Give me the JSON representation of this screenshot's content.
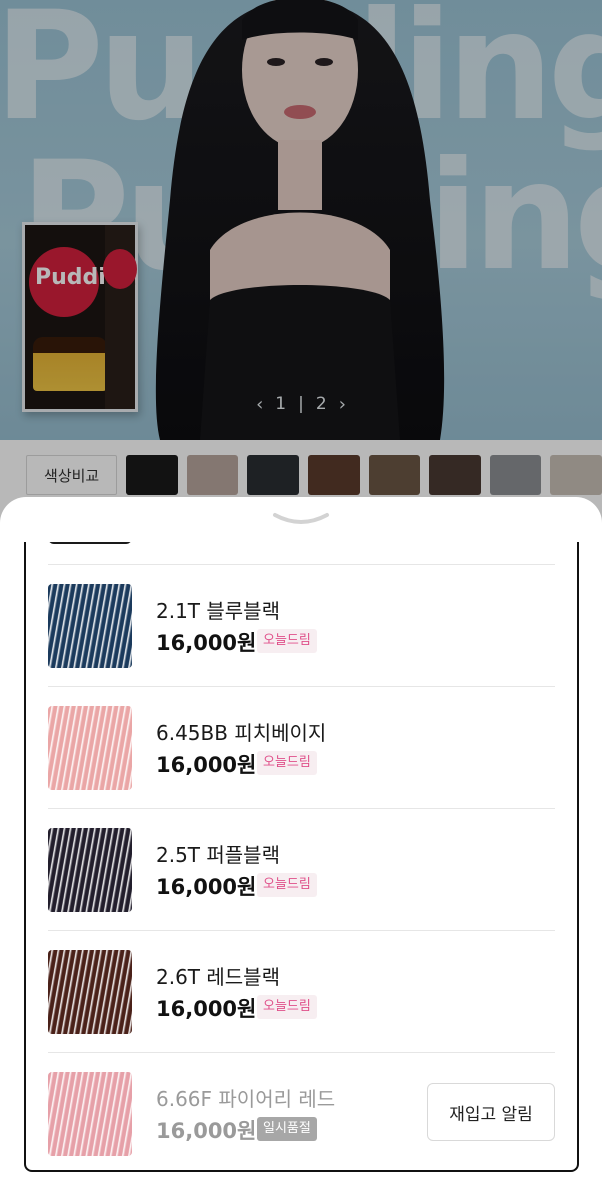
{
  "hero": {
    "bg_text": "Pudding",
    "box_brand": "Pudding",
    "pager": {
      "current": "1",
      "separator": "|",
      "total": "2"
    }
  },
  "swatch_bar": {
    "compare_label": "색상비교",
    "swatch_colors": [
      "#1a1a1a",
      "#b7a69d",
      "#2a2e33",
      "#5a3b2c",
      "#6b5645",
      "#4a3a33",
      "#8c8f94",
      "#c8bfb6"
    ]
  },
  "products": [
    {
      "name": "2.1T 블루블랙",
      "price": "16,000원",
      "badge": "오늘드림",
      "status": "available",
      "swatch": "#1b3a5c"
    },
    {
      "name": "6.45BB 피치베이지",
      "price": "16,000원",
      "badge": "오늘드림",
      "status": "available",
      "swatch": "#eaa6a6"
    },
    {
      "name": "2.5T 퍼플블랙",
      "price": "16,000원",
      "badge": "오늘드림",
      "status": "available",
      "swatch": "#221e2c"
    },
    {
      "name": "2.6T 레드블랙",
      "price": "16,000원",
      "badge": "오늘드림",
      "status": "available",
      "swatch": "#4a2119"
    },
    {
      "name": "6.66F 파이어리 레드",
      "price": "16,000원",
      "badge": "일시품절",
      "status": "soldout",
      "swatch": "#e6a0a8",
      "action": "재입고 알림"
    }
  ]
}
